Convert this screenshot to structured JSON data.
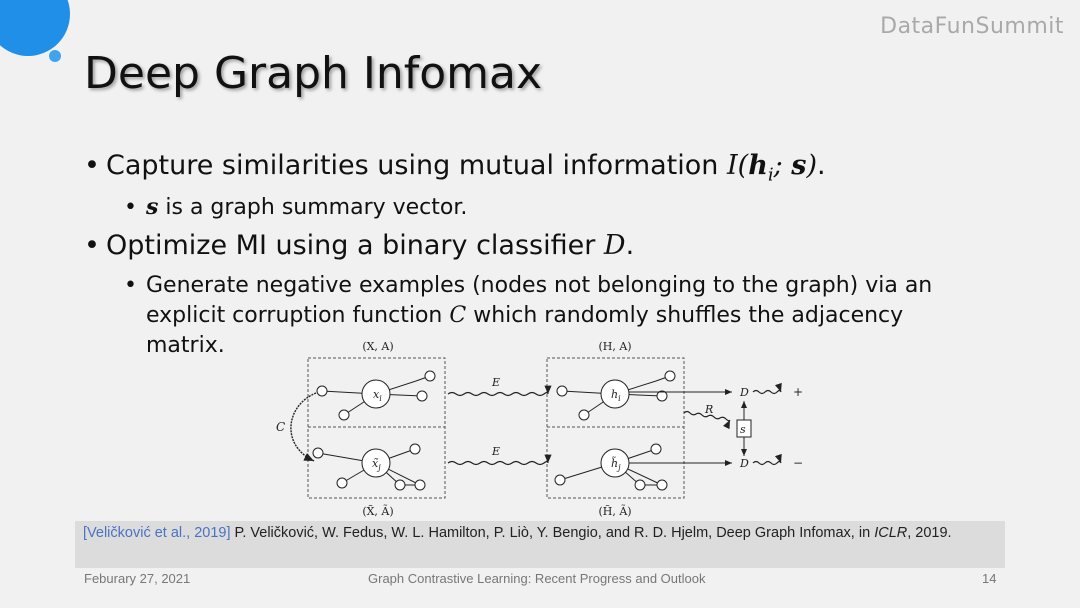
{
  "brand": "DataFunSummit",
  "title": "Deep Graph Infomax",
  "bullets": {
    "b1_text": "Capture similarities using mutual information ",
    "b1_math_I": "I",
    "b1_math_h": "h",
    "b1_math_sub": "i",
    "b1_math_s": "s",
    "b1_end": ".",
    "b1_sub_math": "s",
    "b1_sub_text": " is a graph summary vector.",
    "b2_text": "Optimize MI using a binary classifier ",
    "b2_math": "D",
    "b2_end": ".",
    "b2_sub_line1": "Generate negative examples (nodes not belonging to the graph) via an",
    "b2_sub_line2a": "explicit corruption function ",
    "b2_sub_math": "C",
    "b2_sub_line2b": " which randomly shuffles the adjacency",
    "b2_sub_line3": "matrix."
  },
  "diagram": {
    "top_left_label": "(X, A)",
    "top_right_label": "(H, A)",
    "bottom_left_label": "(X̃, Ã)",
    "bottom_right_label": "(H̃, Ã)",
    "corrupt_label": "C",
    "encoder_top": "E",
    "encoder_bottom": "E",
    "readout_label": "R",
    "disc_top": "D",
    "disc_bottom": "D",
    "plus": "+",
    "minus": "−",
    "summary": "s",
    "node_x": "x",
    "node_x_sub": "i",
    "node_xt": "x̃",
    "node_xt_sub": "j",
    "node_h": "h",
    "node_h_sub": "i",
    "node_ht": "h̃",
    "node_ht_sub": "j"
  },
  "reference": {
    "link": "[Veličković et al., 2019]",
    "text": " P. Veličković, W. Fedus, W. L. Hamilton, P. Liò, Y. Bengio, and R. D. Hjelm, Deep Graph Infomax, in ",
    "venue": "ICLR",
    "text_end": ", 2019."
  },
  "footer": {
    "date": "Feburary 27, 2021",
    "center": "Graph Contrastive Learning: Recent Progress and Outlook",
    "page": "14"
  },
  "colors": {
    "accent_blue": "#1f8fe8",
    "link_blue": "#4a72c4"
  }
}
